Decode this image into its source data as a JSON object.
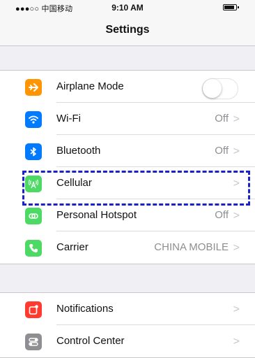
{
  "status_bar": {
    "carrier": "●●●○○ 中国移动",
    "time": "9:10 AM"
  },
  "nav": {
    "title": "Settings"
  },
  "group1": [
    {
      "label": "Airplane Mode",
      "value": "",
      "icon": "airplane-icon",
      "color": "#ff9500"
    },
    {
      "label": "Wi-Fi",
      "value": "Off",
      "icon": "wifi-icon",
      "color": "#007aff"
    },
    {
      "label": "Bluetooth",
      "value": "Off",
      "icon": "bluetooth-icon",
      "color": "#007aff"
    },
    {
      "label": "Cellular",
      "value": "",
      "icon": "cellular-antenna-icon",
      "color": "#4cd964"
    },
    {
      "label": "Personal Hotspot",
      "value": "Off",
      "icon": "hotspot-icon",
      "color": "#4cd964"
    },
    {
      "label": "Carrier",
      "value": "CHINA MOBILE",
      "icon": "phone-icon",
      "color": "#4cd964"
    }
  ],
  "group2": [
    {
      "label": "Notifications",
      "value": "",
      "icon": "notifications-icon",
      "color": "#ff3b30"
    },
    {
      "label": "Control Center",
      "value": "",
      "icon": "control-center-icon",
      "color": "#8e8e93"
    }
  ],
  "chevron": ">",
  "airplane_mode_on": false,
  "highlight_color": "#1c22c9"
}
